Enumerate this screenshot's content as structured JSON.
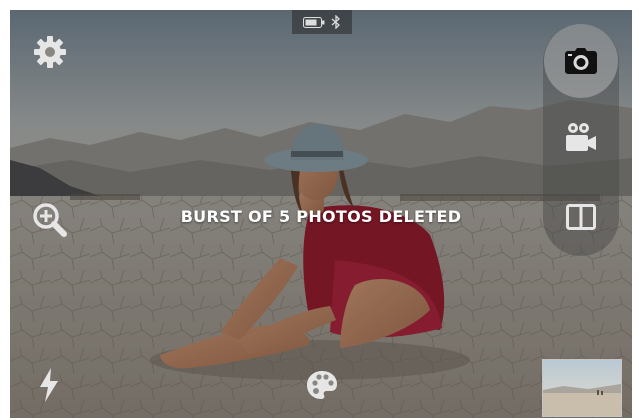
{
  "statusbar": {
    "battery_icon": "battery-icon",
    "bluetooth_icon": "bluetooth-icon"
  },
  "toast": {
    "message": "BURST OF 5 PHOTOS DELETED"
  },
  "controls": {
    "settings_icon": "gear-icon",
    "zoom_icon": "zoom-in-icon",
    "flash_icon": "flash-icon",
    "filters_icon": "palette-icon",
    "modes": [
      {
        "name": "photo",
        "icon": "camera-icon",
        "selected": true
      },
      {
        "name": "video",
        "icon": "video-camera-icon",
        "selected": false
      },
      {
        "name": "split",
        "icon": "split-view-icon",
        "selected": false
      }
    ]
  },
  "colors": {
    "icon": "#e8e8e8",
    "text": "#ffffff",
    "accent_dress": "#9c1f33"
  }
}
